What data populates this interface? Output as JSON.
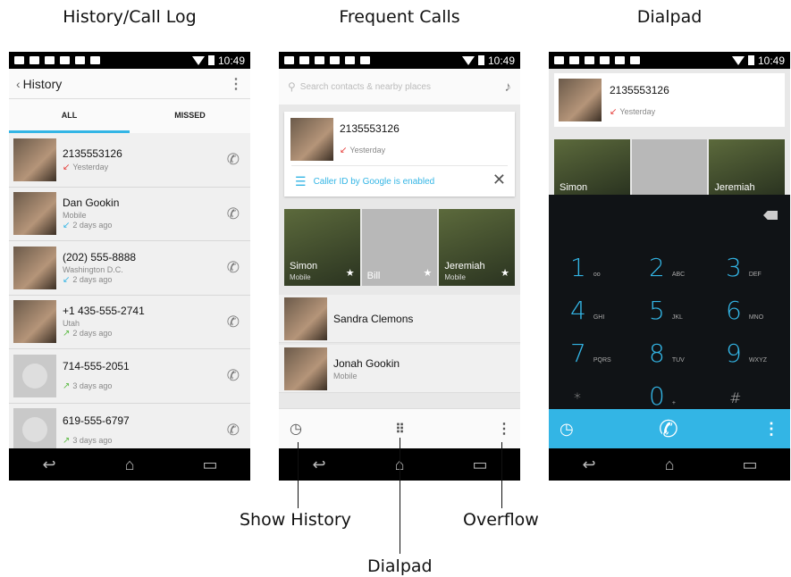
{
  "captions": {
    "history": "History/Call Log",
    "frequent": "Frequent Calls",
    "dialpad": "Dialpad",
    "show_history": "Show History",
    "overflow": "Overflow",
    "dialpad_label": "Dialpad"
  },
  "status": {
    "time": "10:49"
  },
  "history_screen": {
    "title": "History",
    "tabs": [
      "ALL",
      "MISSED"
    ],
    "calls": [
      {
        "name": "2135553126",
        "sub": "",
        "when": "Yesterday",
        "type": "missed"
      },
      {
        "name": "Dan Gookin",
        "sub": "Mobile",
        "when": "2 days ago",
        "type": "incoming"
      },
      {
        "name": "(202) 555-8888",
        "sub": "Washington D.C.",
        "when": "2 days ago",
        "type": "incoming"
      },
      {
        "name": "+1 435-555-2741",
        "sub": "Utah",
        "when": "2 days ago",
        "type": "outgoing"
      },
      {
        "name": "714-555-2051",
        "sub": "",
        "when": "3 days ago",
        "type": "outgoing"
      },
      {
        "name": "619-555-6797",
        "sub": "",
        "when": "3 days ago",
        "type": "outgoing"
      }
    ]
  },
  "frequent_screen": {
    "search_placeholder": "Search contacts & nearby places",
    "recent": {
      "name": "2135553126",
      "when": "Yesterday"
    },
    "caller_id": "Caller ID by Google is enabled",
    "favorites": [
      {
        "name": "Simon",
        "sub": "Mobile"
      },
      {
        "name": "Bill",
        "sub": ""
      },
      {
        "name": "Jeremiah",
        "sub": "Mobile"
      }
    ],
    "contacts": [
      {
        "name": "Sandra Clemons",
        "sub": ""
      },
      {
        "name": "Jonah Gookin",
        "sub": "Mobile"
      }
    ]
  },
  "dialpad_screen": {
    "recent": {
      "name": "2135553126",
      "when": "Yesterday"
    },
    "favorites": [
      "Simon",
      "",
      "Jeremiah"
    ],
    "keys": [
      {
        "num": "1",
        "let": "oo"
      },
      {
        "num": "2",
        "let": "ABC"
      },
      {
        "num": "3",
        "let": "DEF"
      },
      {
        "num": "4",
        "let": "GHI"
      },
      {
        "num": "5",
        "let": "JKL"
      },
      {
        "num": "6",
        "let": "MNO"
      },
      {
        "num": "7",
        "let": "PQRS"
      },
      {
        "num": "8",
        "let": "TUV"
      },
      {
        "num": "9",
        "let": "WXYZ"
      },
      {
        "num": "*",
        "let": ""
      },
      {
        "num": "0",
        "let": "+"
      },
      {
        "num": "#",
        "let": ""
      }
    ]
  },
  "icons": {
    "missed_arrow": "↙",
    "incoming_arrow": "↙",
    "outgoing_arrow": "↗",
    "phone": "✆",
    "history": "◷",
    "star": "★",
    "close": "✕",
    "mic": "🎤"
  },
  "colors": {
    "accent": "#33b5e5",
    "missed": "#e53935",
    "outgoing": "#5dbb45"
  }
}
